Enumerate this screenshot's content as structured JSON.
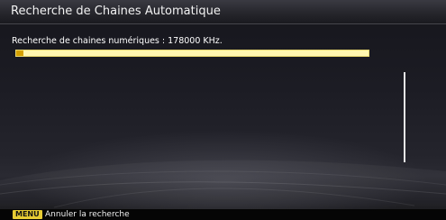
{
  "dialog": {
    "title": "Recherche de Chaines Automatique",
    "status": "Recherche de chaines numériques : 178000 KHz.",
    "progress": 0.02
  },
  "footer": {
    "key_label": "MENU",
    "hint": "Annuler la recherche"
  },
  "colors": {
    "progress_track": "#fff6b0",
    "progress_fill": "#d4a000",
    "menu_key": "#e7cc34"
  }
}
